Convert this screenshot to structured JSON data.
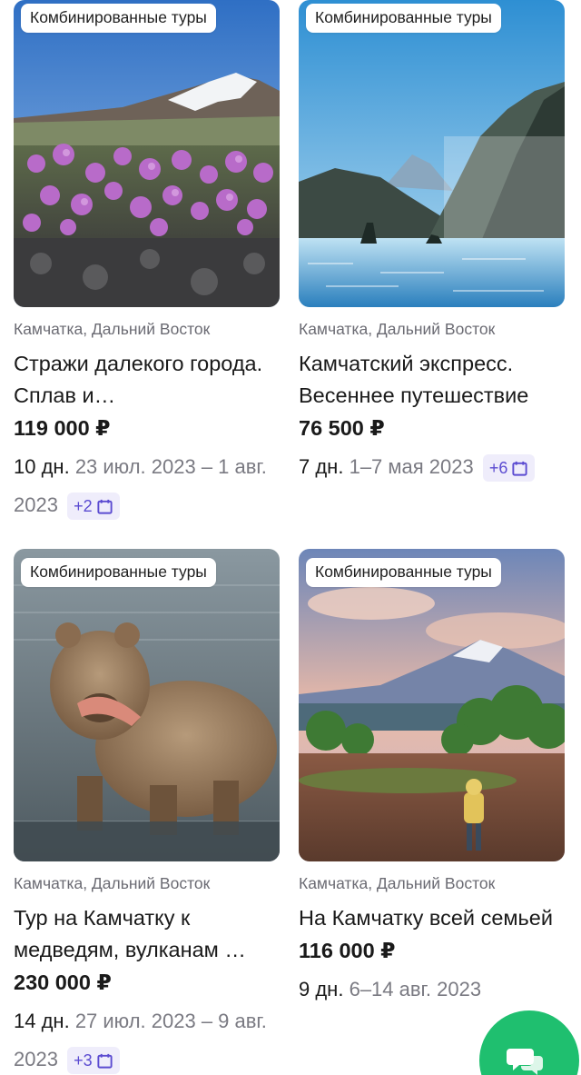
{
  "tours": [
    {
      "tag": "Комбинированные туры",
      "region": "Камчатка, Дальний Восток",
      "title": "Стражи далекого города. Сплав и…",
      "price": "119 000 ₽",
      "duration": "10 дн.",
      "date_range": "23 июл. 2023 – 1 авг. 2023",
      "more_dates": "+2",
      "photo_icon": "mountain-flowers-photo"
    },
    {
      "tag": "Комбинированные туры",
      "region": "Камчатка, Дальний Восток",
      "title": "Камчатский экспресс. Весеннее путешествие",
      "price": "76 500 ₽",
      "duration": "7 дн.",
      "date_range": "1–7 мая 2023",
      "more_dates": "+6",
      "photo_icon": "coastal-cliffs-photo"
    },
    {
      "tag": "Комбинированные туры",
      "region": "Камчатка, Дальний Восток",
      "title": "Тур на Камчатку к медведям, вулканам …",
      "price": "230 000 ₽",
      "duration": "14 дн.",
      "date_range": "27 июл. 2023 – 9 авг. 2023",
      "more_dates": "+3",
      "photo_icon": "bear-with-fish-photo"
    },
    {
      "tag": "Комбинированные туры",
      "region": "Камчатка, Дальний Восток",
      "title": "На Камчатку всей семьей",
      "price": "116 000 ₽",
      "duration": "9 дн.",
      "date_range": "6–14 авг. 2023",
      "more_dates": "",
      "photo_icon": "volcano-child-photo"
    }
  ],
  "colors": {
    "accent": "#5b4bd1",
    "accent_bg": "#efedfb",
    "chat_button": "#1fbf6f",
    "muted_text": "#6b6b73"
  },
  "chat_button_icon": "chat-bubbles-icon"
}
